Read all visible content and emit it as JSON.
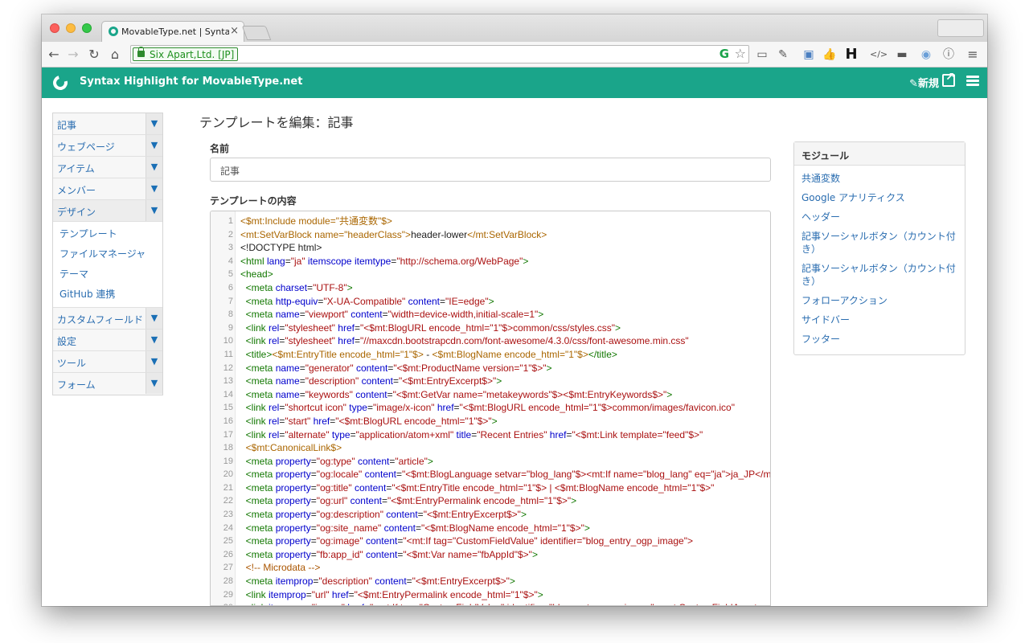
{
  "browser": {
    "tab_title": "MovableType.net | Syntax H",
    "tab_close": "×",
    "address_label": "Six Apart,Ltd. [JP]"
  },
  "app": {
    "title": "Syntax Highlight for MovableType.net",
    "new_label": "新規"
  },
  "sidebar": {
    "items": [
      {
        "label": "記事"
      },
      {
        "label": "ウェブページ"
      },
      {
        "label": "アイテム"
      },
      {
        "label": "メンバー"
      },
      {
        "label": "デザイン"
      },
      {
        "label": "カスタムフィールド"
      },
      {
        "label": "設定"
      },
      {
        "label": "ツール"
      },
      {
        "label": "フォーム"
      }
    ],
    "design_sub": [
      "テンプレート",
      "ファイルマネージャ",
      "テーマ",
      "GitHub 連携"
    ],
    "arrow": "▼"
  },
  "main": {
    "page_title": "テンプレートを編集：記事",
    "name_label": "名前",
    "name_value": "記事",
    "content_label": "テンプレートの内容"
  },
  "modules": {
    "title": "モジュール",
    "items": [
      "共通変数",
      "Google アナリティクス",
      "ヘッダー",
      "記事ソーシャルボタン（カウント付き）",
      "記事ソーシャルボタン（カウント付き）",
      "フォローアクション",
      "サイドバー",
      "フッター"
    ]
  },
  "code_lines": [
    [
      [
        "mt",
        "<$mt:Include module=\"共通変数\"$>"
      ]
    ],
    [
      [
        "mt",
        "<mt:SetVarBlock name=\"headerClass\">"
      ],
      [
        "txt",
        "header-lower"
      ],
      [
        "mt",
        "</mt:SetVarBlock>"
      ]
    ],
    [
      [
        "txt",
        "<!DOCTYPE html>"
      ]
    ],
    [
      [
        "tag",
        "<html "
      ],
      [
        "attr",
        "lang"
      ],
      [
        "txt",
        "="
      ],
      [
        "str",
        "\"ja\""
      ],
      [
        "attr",
        " itemscope itemtype"
      ],
      [
        "txt",
        "="
      ],
      [
        "str",
        "\"http://schema.org/WebPage\""
      ],
      [
        "tag",
        ">"
      ]
    ],
    [
      [
        "tag",
        "<head>"
      ]
    ],
    [
      [
        "tag",
        "  <meta "
      ],
      [
        "attr",
        "charset"
      ],
      [
        "txt",
        "="
      ],
      [
        "str",
        "\"UTF-8\""
      ],
      [
        "tag",
        ">"
      ]
    ],
    [
      [
        "tag",
        "  <meta "
      ],
      [
        "attr",
        "http-equiv"
      ],
      [
        "txt",
        "="
      ],
      [
        "str",
        "\"X-UA-Compatible\""
      ],
      [
        "attr",
        " content"
      ],
      [
        "txt",
        "="
      ],
      [
        "str",
        "\"IE=edge\""
      ],
      [
        "tag",
        ">"
      ]
    ],
    [
      [
        "tag",
        "  <meta "
      ],
      [
        "attr",
        "name"
      ],
      [
        "txt",
        "="
      ],
      [
        "str",
        "\"viewport\""
      ],
      [
        "attr",
        " content"
      ],
      [
        "txt",
        "="
      ],
      [
        "str",
        "\"width=device-width,initial-scale=1\""
      ],
      [
        "tag",
        ">"
      ]
    ],
    [
      [
        "tag",
        "  <link "
      ],
      [
        "attr",
        "rel"
      ],
      [
        "txt",
        "="
      ],
      [
        "str",
        "\"stylesheet\""
      ],
      [
        "attr",
        " href"
      ],
      [
        "txt",
        "="
      ],
      [
        "str",
        "\"<$mt:BlogURL encode_html=\"1\"$>common/css/styles.css\""
      ],
      [
        "tag",
        ">"
      ]
    ],
    [
      [
        "tag",
        "  <link "
      ],
      [
        "attr",
        "rel"
      ],
      [
        "txt",
        "="
      ],
      [
        "str",
        "\"stylesheet\""
      ],
      [
        "attr",
        " href"
      ],
      [
        "txt",
        "="
      ],
      [
        "str",
        "\"//maxcdn.bootstrapcdn.com/font-awesome/4.3.0/css/font-awesome.min.css\""
      ]
    ],
    [
      [
        "tag",
        "  <title>"
      ],
      [
        "mt",
        "<$mt:EntryTitle encode_html=\"1\"$>"
      ],
      [
        "txt",
        " - "
      ],
      [
        "mt",
        "<$mt:BlogName encode_html=\"1\"$>"
      ],
      [
        "tag",
        "</title>"
      ]
    ],
    [
      [
        "tag",
        "  <meta "
      ],
      [
        "attr",
        "name"
      ],
      [
        "txt",
        "="
      ],
      [
        "str",
        "\"generator\""
      ],
      [
        "attr",
        " content"
      ],
      [
        "txt",
        "="
      ],
      [
        "str",
        "\"<$mt:ProductName version=\"1\"$>\""
      ],
      [
        "tag",
        ">"
      ]
    ],
    [
      [
        "tag",
        "  <meta "
      ],
      [
        "attr",
        "name"
      ],
      [
        "txt",
        "="
      ],
      [
        "str",
        "\"description\""
      ],
      [
        "attr",
        " content"
      ],
      [
        "txt",
        "="
      ],
      [
        "str",
        "\"<$mt:EntryExcerpt$>\""
      ],
      [
        "tag",
        ">"
      ]
    ],
    [
      [
        "tag",
        "  <meta "
      ],
      [
        "attr",
        "name"
      ],
      [
        "txt",
        "="
      ],
      [
        "str",
        "\"keywords\""
      ],
      [
        "attr",
        " content"
      ],
      [
        "txt",
        "="
      ],
      [
        "str",
        "\"<$mt:GetVar name=\"metakeywords\"$><$mt:EntryKeywords$>\""
      ],
      [
        "tag",
        ">"
      ]
    ],
    [
      [
        "tag",
        "  <link "
      ],
      [
        "attr",
        "rel"
      ],
      [
        "txt",
        "="
      ],
      [
        "str",
        "\"shortcut icon\""
      ],
      [
        "attr",
        " type"
      ],
      [
        "txt",
        "="
      ],
      [
        "str",
        "\"image/x-icon\""
      ],
      [
        "attr",
        " href"
      ],
      [
        "txt",
        "="
      ],
      [
        "str",
        "\"<$mt:BlogURL encode_html=\"1\"$>common/images/favicon.ico\""
      ]
    ],
    [
      [
        "tag",
        "  <link "
      ],
      [
        "attr",
        "rel"
      ],
      [
        "txt",
        "="
      ],
      [
        "str",
        "\"start\""
      ],
      [
        "attr",
        " href"
      ],
      [
        "txt",
        "="
      ],
      [
        "str",
        "\"<$mt:BlogURL encode_html=\"1\"$>\""
      ],
      [
        "tag",
        ">"
      ]
    ],
    [
      [
        "tag",
        "  <link "
      ],
      [
        "attr",
        "rel"
      ],
      [
        "txt",
        "="
      ],
      [
        "str",
        "\"alternate\""
      ],
      [
        "attr",
        " type"
      ],
      [
        "txt",
        "="
      ],
      [
        "str",
        "\"application/atom+xml\""
      ],
      [
        "attr",
        " title"
      ],
      [
        "txt",
        "="
      ],
      [
        "str",
        "\"Recent Entries\""
      ],
      [
        "attr",
        " href"
      ],
      [
        "txt",
        "="
      ],
      [
        "str",
        "\"<$mt:Link template=\"feed\"$>\""
      ]
    ],
    [
      [
        "mt",
        "  <$mt:CanonicalLink$>"
      ]
    ],
    [
      [
        "tag",
        "  <meta "
      ],
      [
        "attr",
        "property"
      ],
      [
        "txt",
        "="
      ],
      [
        "str",
        "\"og:type\""
      ],
      [
        "attr",
        " content"
      ],
      [
        "txt",
        "="
      ],
      [
        "str",
        "\"article\""
      ],
      [
        "tag",
        ">"
      ]
    ],
    [
      [
        "tag",
        "  <meta "
      ],
      [
        "attr",
        "property"
      ],
      [
        "txt",
        "="
      ],
      [
        "str",
        "\"og:locale\""
      ],
      [
        "attr",
        " content"
      ],
      [
        "txt",
        "="
      ],
      [
        "str",
        "\"<$mt:BlogLanguage setvar=\"blog_lang\"$><mt:If name=\"blog_lang\" eq=\"ja\">ja_JP</mt:If>\""
      ]
    ],
    [
      [
        "tag",
        "  <meta "
      ],
      [
        "attr",
        "property"
      ],
      [
        "txt",
        "="
      ],
      [
        "str",
        "\"og:title\""
      ],
      [
        "attr",
        " content"
      ],
      [
        "txt",
        "="
      ],
      [
        "str",
        "\"<$mt:EntryTitle encode_html=\"1\"$> | <$mt:BlogName encode_html=\"1\"$>\""
      ]
    ],
    [
      [
        "tag",
        "  <meta "
      ],
      [
        "attr",
        "property"
      ],
      [
        "txt",
        "="
      ],
      [
        "str",
        "\"og:url\""
      ],
      [
        "attr",
        " content"
      ],
      [
        "txt",
        "="
      ],
      [
        "str",
        "\"<$mt:EntryPermalink encode_html=\"1\"$>\""
      ],
      [
        "tag",
        ">"
      ]
    ],
    [
      [
        "tag",
        "  <meta "
      ],
      [
        "attr",
        "property"
      ],
      [
        "txt",
        "="
      ],
      [
        "str",
        "\"og:description\""
      ],
      [
        "attr",
        " content"
      ],
      [
        "txt",
        "="
      ],
      [
        "str",
        "\"<$mt:EntryExcerpt$>\""
      ],
      [
        "tag",
        ">"
      ]
    ],
    [
      [
        "tag",
        "  <meta "
      ],
      [
        "attr",
        "property"
      ],
      [
        "txt",
        "="
      ],
      [
        "str",
        "\"og:site_name\""
      ],
      [
        "attr",
        " content"
      ],
      [
        "txt",
        "="
      ],
      [
        "str",
        "\"<$mt:BlogName encode_html=\"1\"$>\""
      ],
      [
        "tag",
        ">"
      ]
    ],
    [
      [
        "tag",
        "  <meta "
      ],
      [
        "attr",
        "property"
      ],
      [
        "txt",
        "="
      ],
      [
        "str",
        "\"og:image\""
      ],
      [
        "attr",
        " content"
      ],
      [
        "txt",
        "="
      ],
      [
        "str",
        "\"<mt:If tag=\"CustomFieldValue\" identifier=\"blog_entry_ogp_image\">"
      ]
    ],
    [
      [
        "tag",
        "  <meta "
      ],
      [
        "attr",
        "property"
      ],
      [
        "txt",
        "="
      ],
      [
        "str",
        "\"fb:app_id\""
      ],
      [
        "attr",
        " content"
      ],
      [
        "txt",
        "="
      ],
      [
        "str",
        "\"<$mt:Var name=\"fbAppId\"$>\""
      ],
      [
        "tag",
        ">"
      ]
    ],
    [
      [
        "cmt",
        "  <!-- Microdata -->"
      ]
    ],
    [
      [
        "tag",
        "  <meta "
      ],
      [
        "attr",
        "itemprop"
      ],
      [
        "txt",
        "="
      ],
      [
        "str",
        "\"description\""
      ],
      [
        "attr",
        " content"
      ],
      [
        "txt",
        "="
      ],
      [
        "str",
        "\"<$mt:EntryExcerpt$>\""
      ],
      [
        "tag",
        ">"
      ]
    ],
    [
      [
        "tag",
        "  <link "
      ],
      [
        "attr",
        "itemprop"
      ],
      [
        "txt",
        "="
      ],
      [
        "str",
        "\"url\""
      ],
      [
        "attr",
        " href"
      ],
      [
        "txt",
        "="
      ],
      [
        "str",
        "\"<$mt:EntryPermalink encode_html=\"1\"$>\""
      ],
      [
        "tag",
        ">"
      ]
    ],
    [
      [
        "tag",
        "  <link "
      ],
      [
        "attr",
        "itemprop"
      ],
      [
        "txt",
        "="
      ],
      [
        "str",
        "\"image\""
      ],
      [
        "attr",
        " href"
      ],
      [
        "txt",
        "="
      ],
      [
        "str",
        "\"<mt:If tag=\"CustomFieldValue\" identifier=\"blog_entry_ogp_image\"><mt:CustomFieldAsset>"
      ]
    ]
  ]
}
